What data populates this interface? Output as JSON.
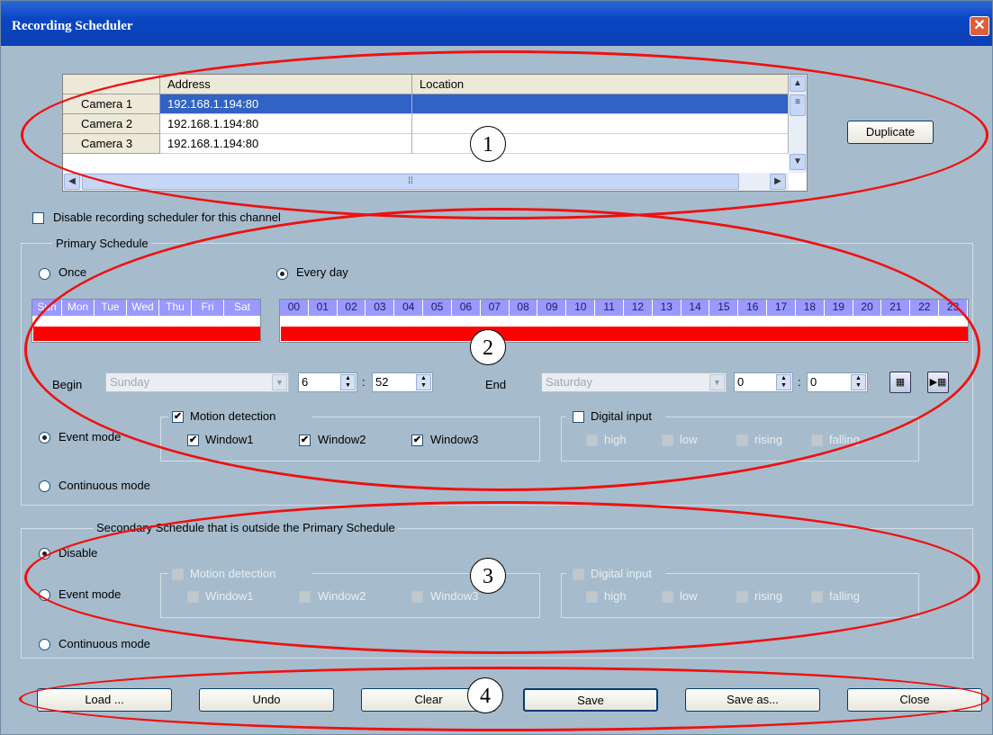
{
  "window": {
    "title": "Recording Scheduler",
    "close": "✕"
  },
  "grid": {
    "headers": [
      "Address",
      "Location"
    ],
    "rows": [
      {
        "name": "Camera 1",
        "address": "192.168.1.194:80",
        "location": ""
      },
      {
        "name": "Camera 2",
        "address": "192.168.1.194:80",
        "location": ""
      },
      {
        "name": "Camera 3",
        "address": "192.168.1.194:80",
        "location": ""
      }
    ]
  },
  "duplicate_label": "Duplicate",
  "disable_sched_label": "Disable recording scheduler for this channel",
  "primary": {
    "group_label": "Primary Schedule",
    "once_label": "Once",
    "everyday_label": "Every day",
    "days": [
      "Sun",
      "Mon",
      "Tue",
      "Wed",
      "Thu",
      "Fri",
      "Sat"
    ],
    "hours": [
      "00",
      "01",
      "02",
      "03",
      "04",
      "05",
      "06",
      "07",
      "08",
      "09",
      "10",
      "11",
      "12",
      "13",
      "14",
      "15",
      "16",
      "17",
      "18",
      "19",
      "20",
      "21",
      "22",
      "23"
    ],
    "begin_label": "Begin",
    "begin_day": "Sunday",
    "begin_hour": "6",
    "begin_min": "52",
    "end_label": "End",
    "end_day": "Saturday",
    "end_hour": "0",
    "end_min": "0",
    "colon": ":",
    "event_mode_label": "Event mode",
    "continuous_label": "Continuous mode",
    "motion_label": "Motion detection",
    "window1": "Window1",
    "window2": "Window2",
    "window3": "Window3",
    "digital_label": "Digital input",
    "high": "high",
    "low": "low",
    "rising": "rising",
    "falling": "falling"
  },
  "secondary": {
    "group_label": "Secondary Schedule that is outside the Primary Schedule",
    "disable_label": "Disable",
    "event_mode_label": "Event mode",
    "continuous_label": "Continuous mode",
    "motion_label": "Motion detection",
    "window1": "Window1",
    "window2": "Window2",
    "window3": "Window3",
    "digital_label": "Digital input",
    "high": "high",
    "low": "low",
    "rising": "rising",
    "falling": "falling"
  },
  "buttons": {
    "load": "Load ...",
    "undo": "Undo",
    "clear": "Clear",
    "save": "Save",
    "save_as": "Save as...",
    "close": "Close"
  },
  "callouts": [
    "1",
    "2",
    "3",
    "4"
  ],
  "colors": {
    "schedule_bar": "#ff0000",
    "ellipse": "#e11111",
    "day_header": "#9999ff"
  }
}
